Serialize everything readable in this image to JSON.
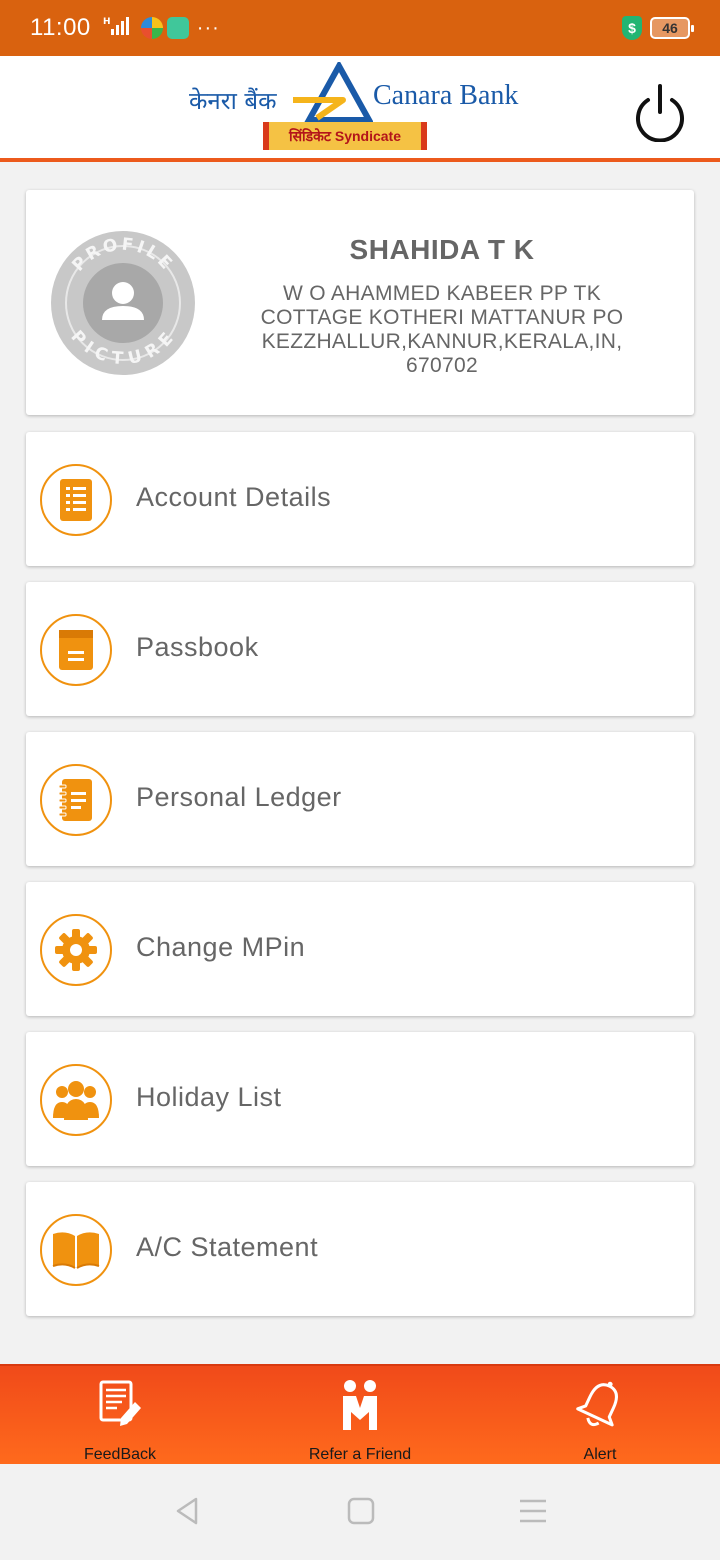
{
  "status_bar": {
    "time": "11:00",
    "signal": "H",
    "more": "···",
    "battery": "46"
  },
  "header": {
    "logo_hindi": "केनरा बैंक",
    "logo_english": "Canara Bank",
    "syndicate_text": "सिंडिकेट Syndicate",
    "accent_color": "#ec5a1c",
    "brand_blue": "#1a5aa8"
  },
  "profile": {
    "picture_text_top": "PROFILE",
    "picture_text_bottom": "PICTURE",
    "name": "SHAHIDA T K",
    "address_lines": [
      "W O AHAMMED KABEER PP TK",
      "COTTAGE KOTHERI MATTANUR PO",
      "KEZZHALLUR,KANNUR,KERALA,IN,",
      "670702"
    ]
  },
  "menu": [
    {
      "label": "Account Details",
      "icon": "list-icon"
    },
    {
      "label": "Passbook",
      "icon": "passbook-icon"
    },
    {
      "label": "Personal Ledger",
      "icon": "ledger-icon"
    },
    {
      "label": "Change MPin",
      "icon": "gear-icon"
    },
    {
      "label": "Holiday List",
      "icon": "group-icon"
    },
    {
      "label": "A/C Statement",
      "icon": "open-book-icon"
    }
  ],
  "bottom_nav": [
    {
      "label": "FeedBack",
      "icon": "feedback-icon"
    },
    {
      "label": "Refer a Friend",
      "icon": "refer-friend-icon"
    },
    {
      "label": "Alert",
      "icon": "bell-icon"
    }
  ],
  "colors": {
    "status_bar": "#d9620f",
    "icon_orange": "#f0920f",
    "nav_orange": "#f04a1a"
  }
}
